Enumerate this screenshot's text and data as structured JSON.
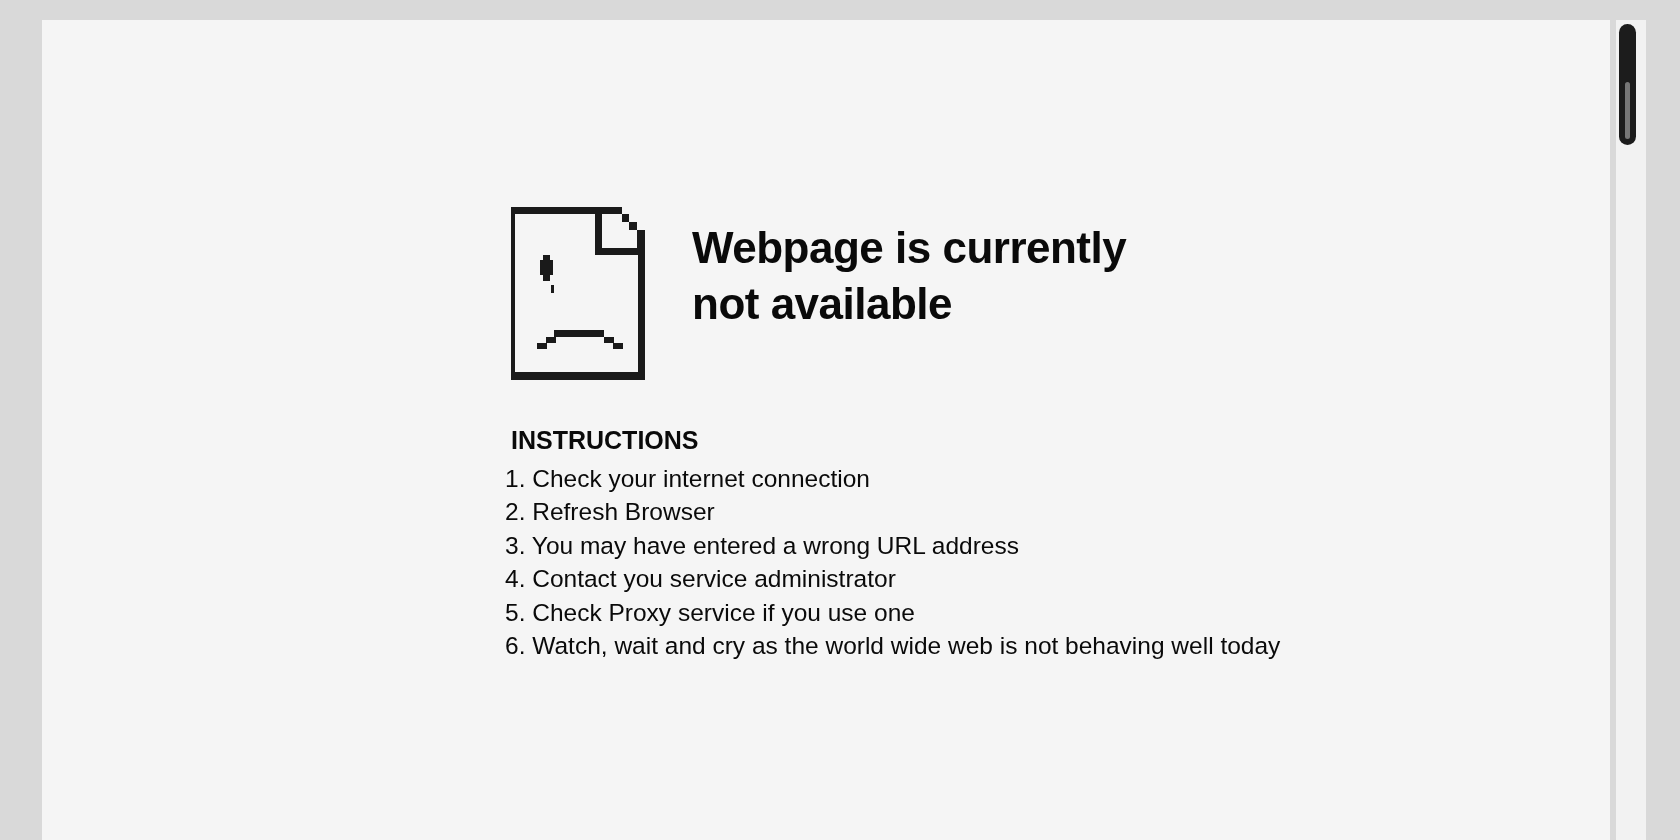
{
  "error": {
    "title_lines": [
      "Webpage is currently",
      "not available"
    ]
  },
  "instructions": {
    "heading": "INSTRUCTIONS",
    "items": [
      "1. Check your internet connection",
      "2. Refresh Browser",
      "3. You may have entered a wrong URL address",
      "4. Contact you service administrator",
      "5. Check Proxy service if you use one",
      "6. Watch, wait and cry as the world wide web is not behaving well today"
    ]
  }
}
